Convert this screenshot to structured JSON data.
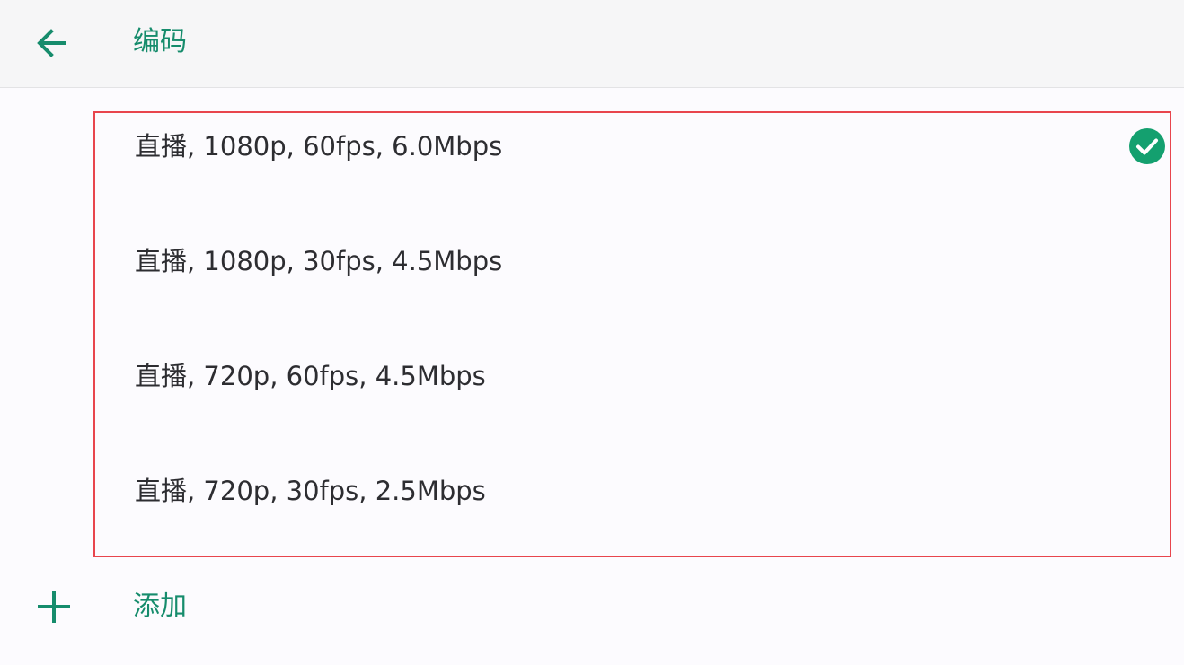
{
  "header": {
    "back_icon": "arrow-left-icon",
    "title": "编码"
  },
  "encodings": {
    "items": [
      {
        "label": "直播, 1080p, 60fps, 6.0Mbps",
        "selected": true
      },
      {
        "label": "直播, 1080p, 30fps, 4.5Mbps",
        "selected": false
      },
      {
        "label": "直播, 720p, 60fps, 4.5Mbps",
        "selected": false
      },
      {
        "label": "直播, 720p, 30fps, 2.5Mbps",
        "selected": false
      }
    ],
    "selected_icon": "check-circle-icon"
  },
  "add": {
    "icon": "plus-icon",
    "label": "添加"
  },
  "colors": {
    "accent": "#168c6c",
    "highlight_border": "#e8454d",
    "check_fill": "#14a06f"
  }
}
